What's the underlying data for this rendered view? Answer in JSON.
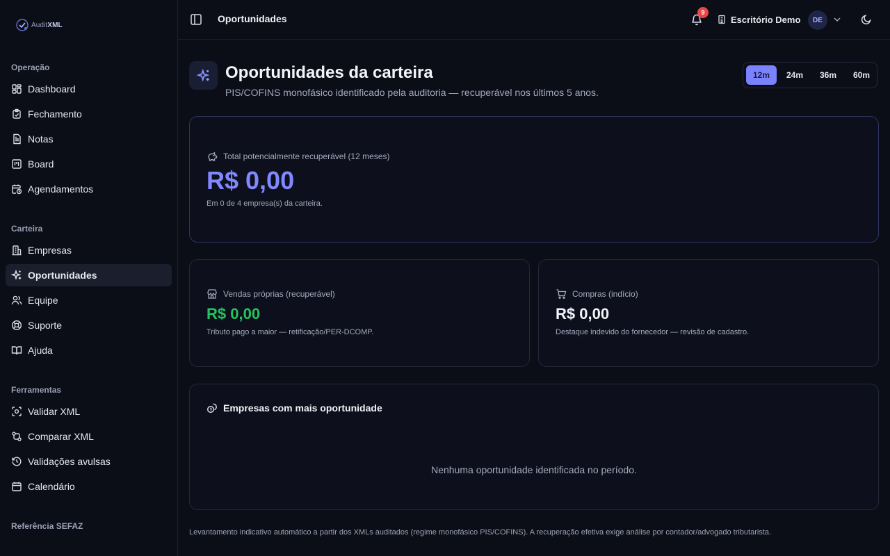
{
  "brand": {
    "name_prefix": "Audit",
    "name_suffix": "XML"
  },
  "sidebar": {
    "sections": [
      {
        "title": "Operação",
        "items": [
          {
            "label": "Dashboard",
            "icon": "dashboard-icon"
          },
          {
            "label": "Fechamento",
            "icon": "clipboard-check-icon"
          },
          {
            "label": "Notas",
            "icon": "file-text-icon"
          },
          {
            "label": "Board",
            "icon": "kanban-icon"
          },
          {
            "label": "Agendamentos",
            "icon": "calendar-clock-icon"
          }
        ]
      },
      {
        "title": "Carteira",
        "items": [
          {
            "label": "Empresas",
            "icon": "building-icon"
          },
          {
            "label": "Oportunidades",
            "icon": "sparkles-icon",
            "active": true
          },
          {
            "label": "Equipe",
            "icon": "users-icon"
          },
          {
            "label": "Suporte",
            "icon": "life-buoy-icon"
          },
          {
            "label": "Ajuda",
            "icon": "book-open-icon"
          }
        ]
      },
      {
        "title": "Ferramentas",
        "items": [
          {
            "label": "Validar XML",
            "icon": "scan-icon"
          },
          {
            "label": "Comparar XML",
            "icon": "git-compare-icon"
          },
          {
            "label": "Validações avulsas",
            "icon": "history-icon"
          },
          {
            "label": "Calendário",
            "icon": "calendar-icon"
          }
        ]
      },
      {
        "title": "Referência SEFAZ",
        "items": []
      }
    ]
  },
  "header": {
    "page_title": "Oportunidades",
    "notification_count": "9",
    "office_name": "Escritório Demo",
    "avatar_initials": "DE"
  },
  "main": {
    "title": "Oportunidades da carteira",
    "subtitle": "PIS/COFINS monofásico identificado pela auditoria — recuperável nos últimos 5 anos.",
    "periods": [
      {
        "label": "12m",
        "selected": true
      },
      {
        "label": "24m",
        "selected": false
      },
      {
        "label": "36m",
        "selected": false
      },
      {
        "label": "60m",
        "selected": false
      }
    ],
    "total": {
      "label": "Total potencialmente recuperável (12 meses)",
      "value": "R$ 0,00",
      "note": "Em 0 de 4 empresa(s) da carteira."
    },
    "vendas": {
      "label": "Vendas próprias (recuperável)",
      "value": "R$ 0,00",
      "note": "Tributo pago a maior — retificação/PER-DCOMP."
    },
    "compras": {
      "label": "Compras (indício)",
      "value": "R$ 0,00",
      "note": "Destaque indevido do fornecedor — revisão de cadastro."
    },
    "empresas": {
      "heading": "Empresas com mais oportunidade",
      "empty": "Nenhuma oportunidade identificada no período."
    },
    "footnote": "Levantamento indicativo automático a partir dos XMLs auditados (regime monofásico PIS/COFINS). A recuperação efetiva exige análise por contador/advogado tributarista."
  },
  "colors": {
    "accent": "#7b82ff",
    "total_value": "#8188ff",
    "vendas_value": "#22c55e",
    "compras_value": "#f2f4fa",
    "badge": "#ef4444"
  }
}
